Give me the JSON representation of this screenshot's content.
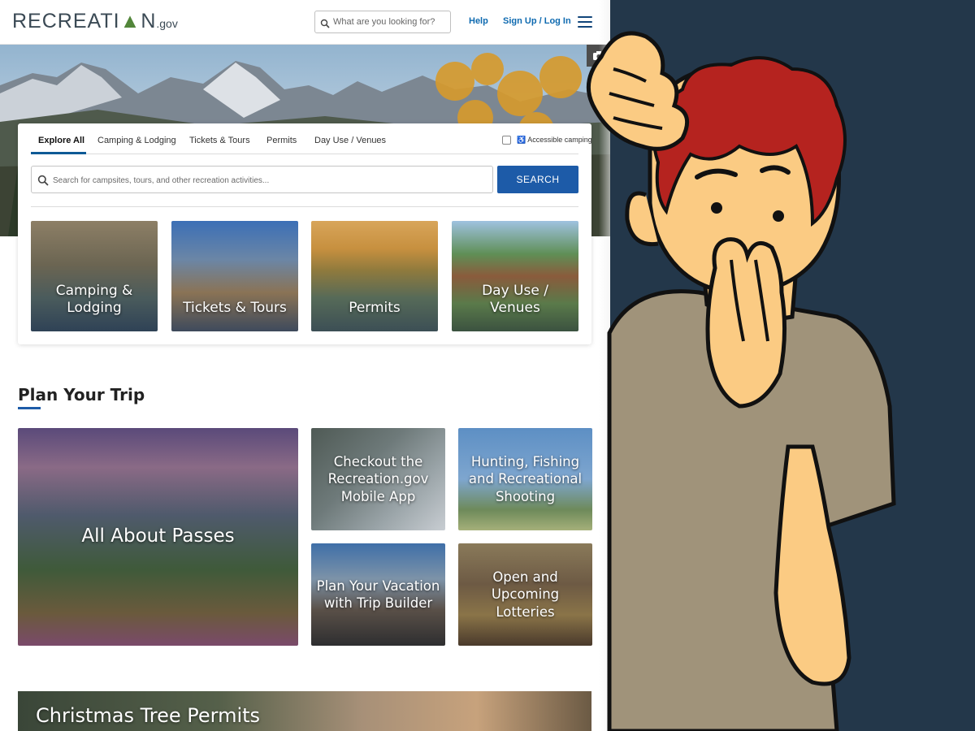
{
  "header": {
    "logo_main": "RECREATI",
    "logo_tree": "▲",
    "logo_rest": "N",
    "logo_suffix": ".gov",
    "search_placeholder": "What are you looking for?",
    "help_label": "Help",
    "signup_label": "Sign Up / Log In"
  },
  "search_card": {
    "tabs": [
      {
        "label": "Explore All"
      },
      {
        "label": "Camping & Lodging"
      },
      {
        "label": "Tickets & Tours"
      },
      {
        "label": "Permits"
      },
      {
        "label": "Day Use / Venues"
      }
    ],
    "accessible_label": "Accessible camping",
    "search_placeholder": "Search for campsites, tours, and other recreation activities...",
    "search_button": "SEARCH",
    "categories": [
      {
        "label": "Camping & Lodging"
      },
      {
        "label": "Tickets & Tours"
      },
      {
        "label": "Permits"
      },
      {
        "label": "Day Use / Venues"
      }
    ]
  },
  "plan": {
    "title": "Plan Your Trip",
    "tiles": [
      {
        "label": "All About Passes"
      },
      {
        "label": "Checkout the Recreation.gov Mobile App"
      },
      {
        "label": "Hunting, Fishing and Recreational Shooting"
      },
      {
        "label": "Plan Your Vacation with Trip Builder"
      },
      {
        "label": "Open and Upcoming Lotteries"
      }
    ]
  },
  "banner": {
    "label": "Christmas Tree Permits"
  },
  "colors": {
    "brand_blue": "#1d5ba8",
    "link_blue": "#0e6ab0",
    "background_navy": "#23374a",
    "skin": "#fbcb83",
    "hair": "#b5231f",
    "shirt": "#a0937a"
  }
}
